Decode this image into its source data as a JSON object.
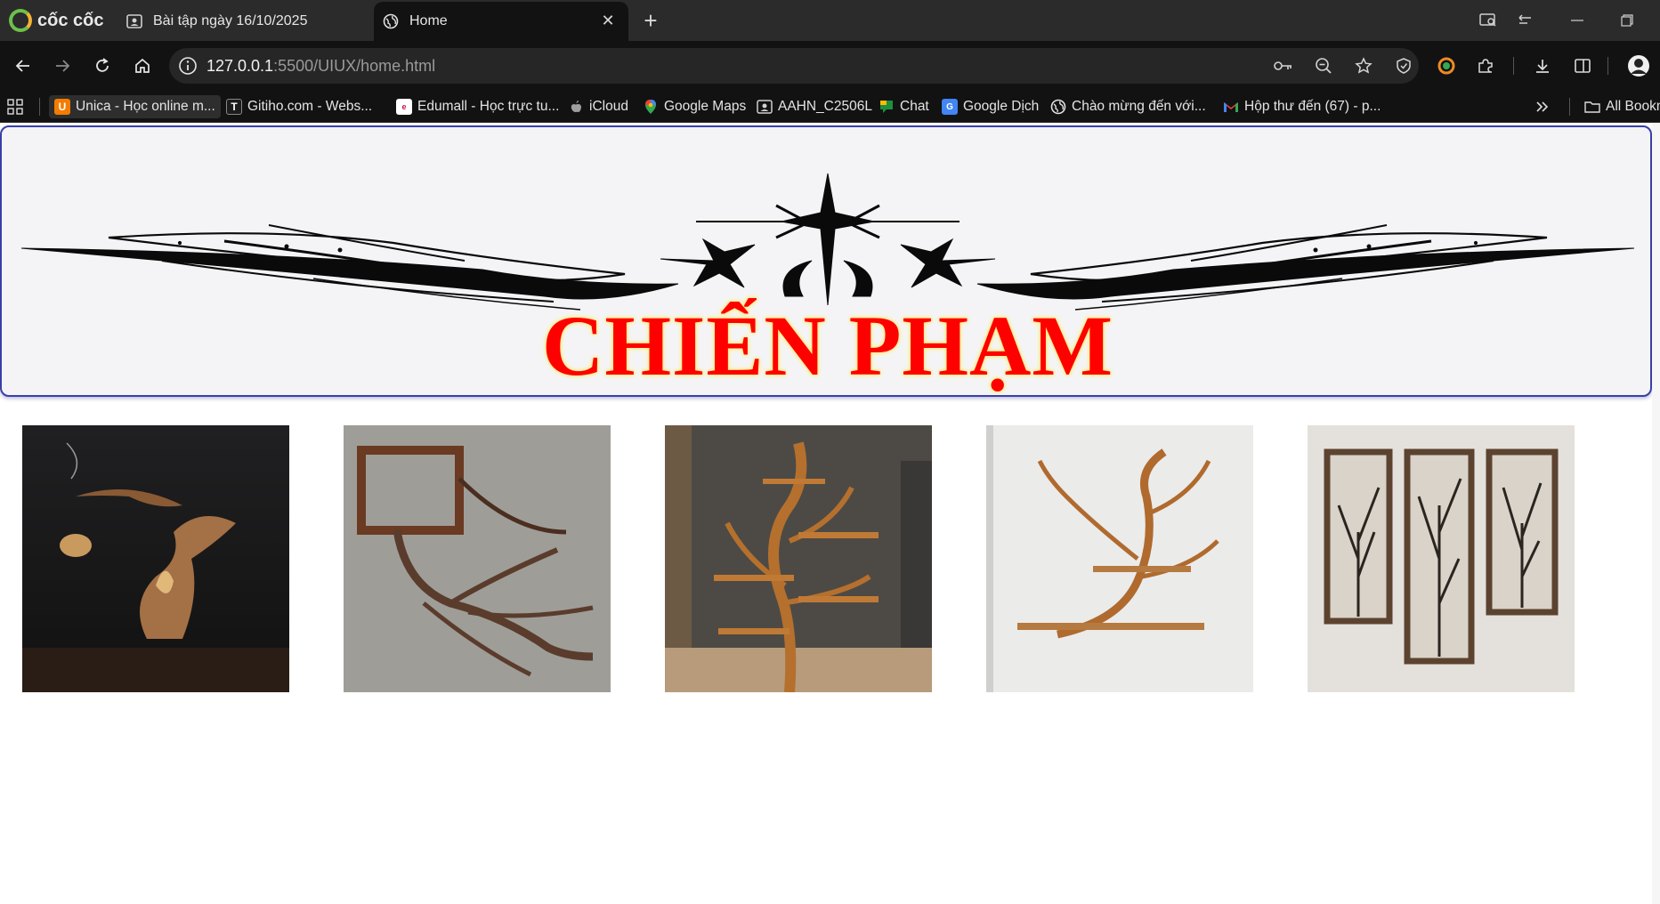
{
  "browser": {
    "brand": "cốc cốc",
    "tabs": [
      {
        "title": "Bài tập ngày 16/10/2025",
        "active": false
      },
      {
        "title": "Home",
        "active": true
      }
    ],
    "url_host": "127.0.0.1",
    "url_path": ":5500/UIUX/home.html",
    "bookmarks": [
      {
        "label": "Unica - Học online m...",
        "icon": "unica-icon",
        "color": "#f57c00"
      },
      {
        "label": "Gitiho.com - Webs...",
        "icon": "gitiho-icon",
        "color": "#1c1c1c"
      },
      {
        "label": "Edumall - Học trực tu...",
        "icon": "edumall-icon",
        "color": "#ffffff"
      },
      {
        "label": "iCloud",
        "icon": "apple-icon",
        "color": "#9e9e9e"
      },
      {
        "label": "Google Maps",
        "icon": "google-maps-icon",
        "color": "#34a853"
      },
      {
        "label": "AAHN_C2506L",
        "icon": "profile-icon",
        "color": "#e0e0e0"
      },
      {
        "label": "Chat",
        "icon": "google-chat-icon",
        "color": "#1e8e3e"
      },
      {
        "label": "Google Dịch",
        "icon": "google-translate-icon",
        "color": "#4285f4"
      },
      {
        "label": "Chào mừng đến với...",
        "icon": "globe-icon",
        "color": "#e0e0e0"
      },
      {
        "label": "Hộp thư đến (67) - p...",
        "icon": "gmail-icon",
        "color": "#ea4335"
      }
    ],
    "all_bookmarks": "All Bookm"
  },
  "page": {
    "banner_title": "CHIẾN PHẠM",
    "title_color": "#ff0000",
    "border_color": "#3a3fa8",
    "gallery": [
      {
        "name": "driftwood-incense-sculpture"
      },
      {
        "name": "branch-mirror-frame"
      },
      {
        "name": "tree-wall-shelf"
      },
      {
        "name": "branch-floating-shelves"
      },
      {
        "name": "framed-tree-triptych"
      }
    ]
  }
}
